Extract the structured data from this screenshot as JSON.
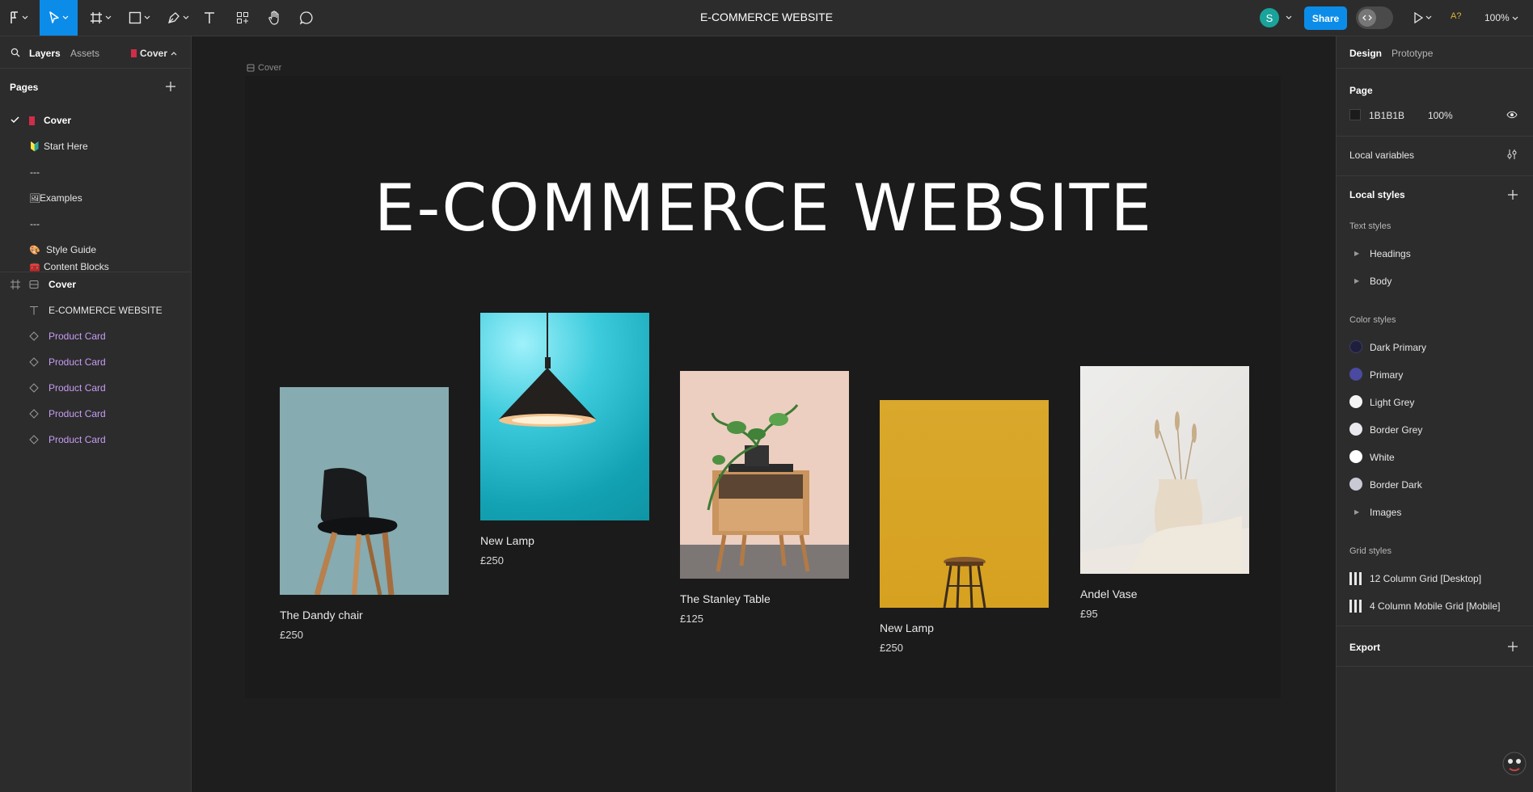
{
  "toolbar": {
    "file_title": "E-COMMERCE WEBSITE",
    "share_label": "Share",
    "avatar_initial": "S",
    "zoom": "100%",
    "a_label": "A?"
  },
  "left_panel": {
    "tab_layers": "Layers",
    "tab_assets": "Assets",
    "current_page": "Cover",
    "pages_title": "Pages",
    "pages": [
      {
        "icon": "📕",
        "label": "Cover",
        "selected": true
      },
      {
        "icon": "🔰",
        "label": "Start Here"
      },
      {
        "icon": "",
        "label": "---"
      },
      {
        "icon": "🖼",
        "label": "Examples"
      },
      {
        "icon": "",
        "label": "---"
      },
      {
        "icon": "🎨",
        "label": "Style Guide"
      },
      {
        "icon": "🧰",
        "label": "Content Blocks"
      }
    ],
    "layers": [
      {
        "type": "frame",
        "label": "Cover"
      },
      {
        "type": "text",
        "label": "E-COMMERCE WEBSITE"
      },
      {
        "type": "component",
        "label": "Product Card"
      },
      {
        "type": "component",
        "label": "Product Card"
      },
      {
        "type": "component",
        "label": "Product Card"
      },
      {
        "type": "component",
        "label": "Product Card"
      },
      {
        "type": "component",
        "label": "Product Card"
      }
    ]
  },
  "canvas": {
    "frame_label": "Cover",
    "hero_title": "E-COMMERCE WEBSITE",
    "products": [
      {
        "name": "The Dandy chair",
        "price": "£250",
        "image": "chair",
        "bg": "#86abb0"
      },
      {
        "name": "New Lamp",
        "price": "£250",
        "image": "pendant-lamp",
        "bg": "#1aa9b8"
      },
      {
        "name": "The Stanley Table",
        "price": "£125",
        "image": "side-table",
        "bg": "#eccfc0"
      },
      {
        "name": "New Lamp",
        "price": "£250",
        "image": "stool",
        "bg": "#d9a524"
      },
      {
        "name": "Andel Vase",
        "price": "£95",
        "image": "vase",
        "bg": "#e6e4e1"
      }
    ]
  },
  "right_panel": {
    "tab_design": "Design",
    "tab_prototype": "Prototype",
    "page_title": "Page",
    "page_color": "1B1B1B",
    "page_opacity": "100%",
    "local_variables": "Local variables",
    "local_styles": "Local styles",
    "text_styles_title": "Text styles",
    "text_styles": [
      "Headings",
      "Body"
    ],
    "color_styles_title": "Color styles",
    "color_styles": [
      {
        "name": "Dark Primary",
        "color": "#1f1f3d"
      },
      {
        "name": "Primary",
        "color": "#4a4aa0"
      },
      {
        "name": "Light Grey",
        "color": "#f4f4f4"
      },
      {
        "name": "Border Grey",
        "color": "#e8e8ee"
      },
      {
        "name": "White",
        "color": "#ffffff"
      },
      {
        "name": "Border Dark",
        "color": "#c9c9d6"
      }
    ],
    "images_label": "Images",
    "grid_styles_title": "Grid styles",
    "grid_styles": [
      "12 Column Grid [Desktop]",
      "4 Column Mobile Grid [Mobile]"
    ],
    "export_title": "Export"
  }
}
